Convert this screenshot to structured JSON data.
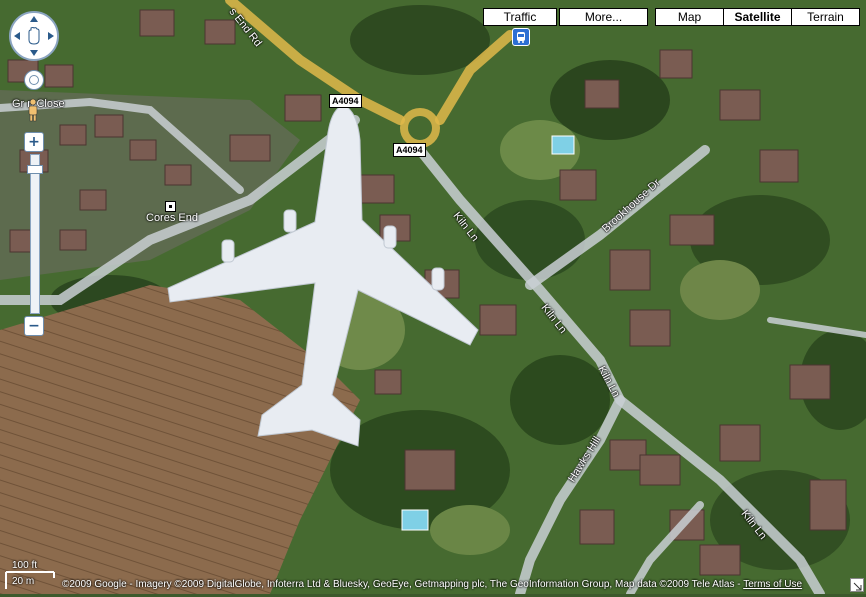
{
  "map_type_buttons": {
    "traffic": "Traffic",
    "more": "More...",
    "map": "Map",
    "satellite": "Satellite",
    "terrain": "Terrain",
    "active": "Satellite"
  },
  "roads": {
    "a4094_top": "A4094",
    "a4094_mid": "A4094",
    "hawks_end_rd": "s End Rd",
    "green_close": "Gr n Close",
    "brookhouse_dr": "Brookhouse Dr",
    "kiln_ln_1": "Kiln Ln",
    "kiln_ln_2": "Kiln Ln",
    "kiln_ln_3": "Kiln Ln",
    "kiln_ln_4": "Kiln Ln",
    "hawks_hill": "Hawks Hill"
  },
  "pois": {
    "cores_end": "Cores End"
  },
  "scale": {
    "feet": "100 ft",
    "meters": "20 m"
  },
  "copyright": {
    "text": "©2009 Google - Imagery ©2009 DigitalGlobe, Infoterra Ltd & Bluesky, GeoEye, Getmapping plc, The GeoInformation Group, Map data ©2009 Tele Atlas - ",
    "terms": "Terms of Use"
  },
  "zoom": {
    "in": "+",
    "out": "−"
  },
  "colors": {
    "highway": "#e0b84a",
    "road": "#c9cfd4",
    "field": "#8a6a4c",
    "trees": "#2f4f22",
    "grass": "#5c7a3a"
  },
  "icons": [
    "bus-stop-icon",
    "pan-control-icon",
    "pegman-icon",
    "cores-end-poi-icon",
    "resize-corner-icon"
  ]
}
